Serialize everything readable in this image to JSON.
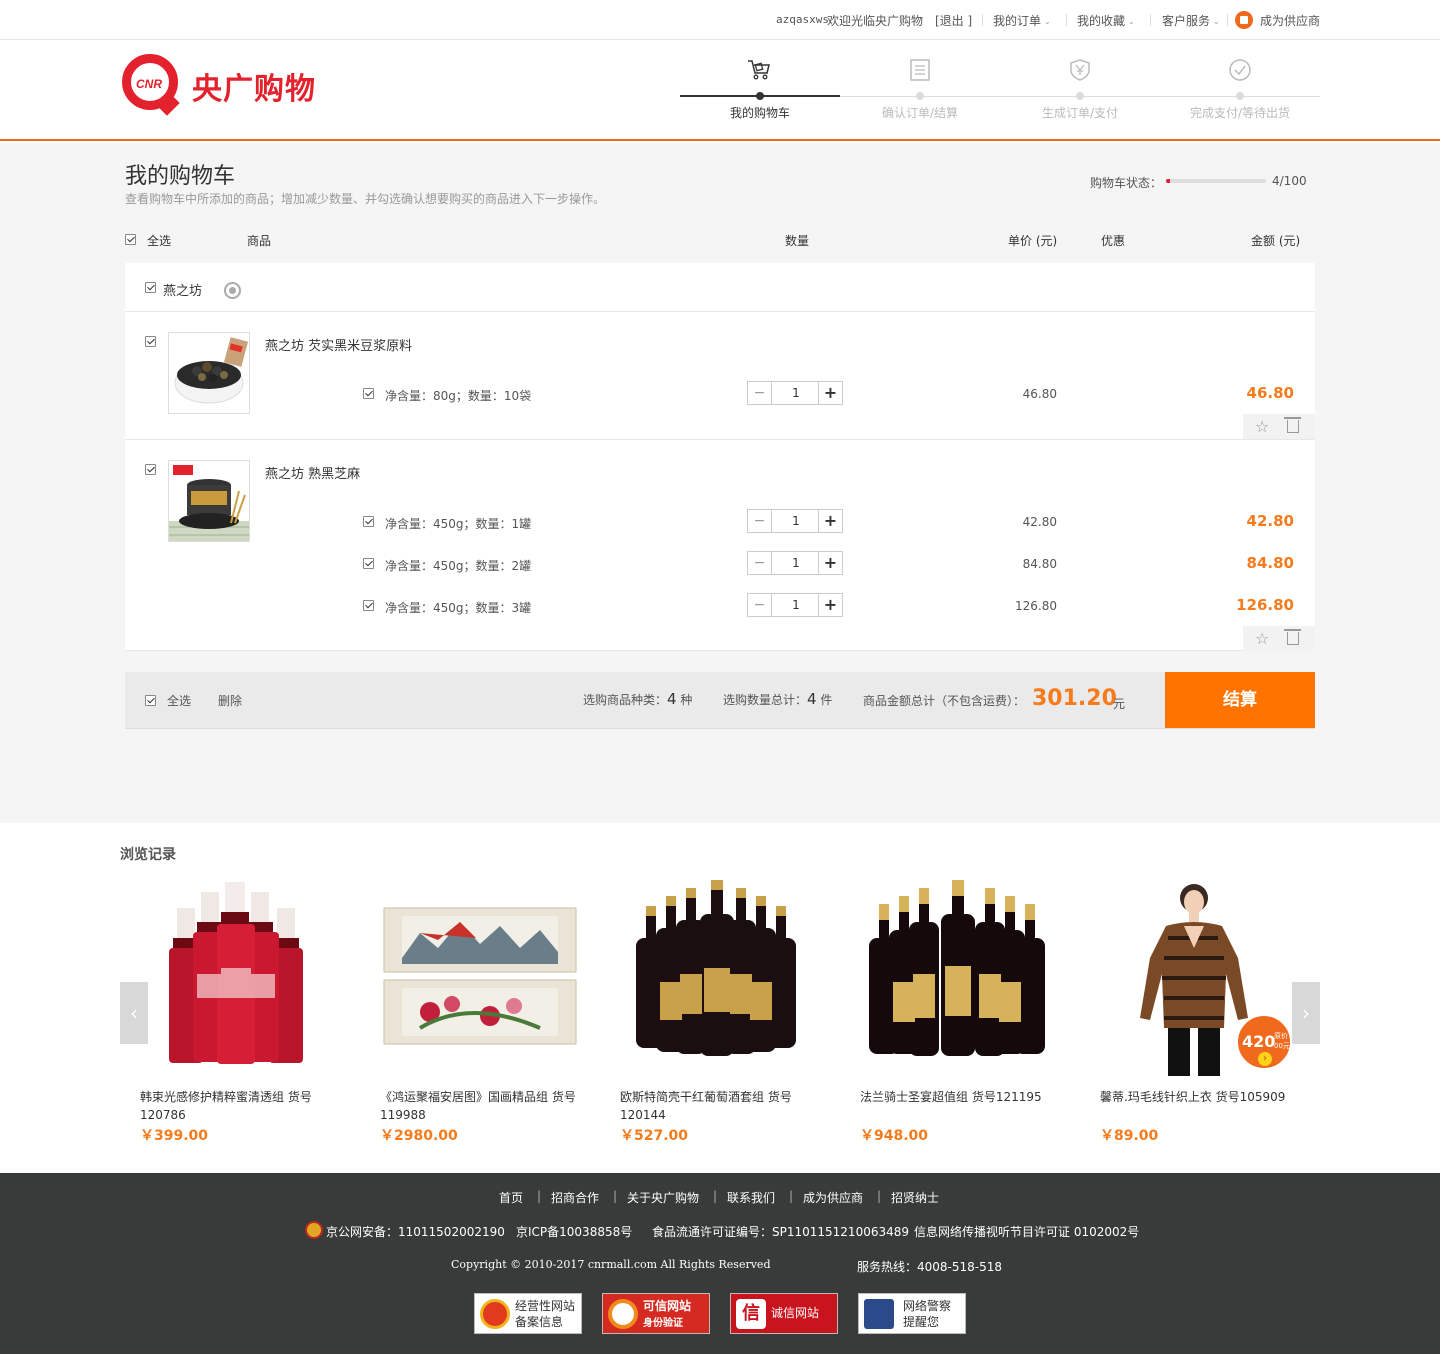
{
  "topbar": {
    "username": "azqasxws",
    "welcome": "欢迎光临央广购物",
    "logout": "[退出 ]",
    "my_orders": "我的订单",
    "my_favorites": "我的收藏",
    "customer_service": "客户服务",
    "become_supplier": "成为供应商"
  },
  "logo": {
    "brand": "央广购物",
    "mark": "CNR"
  },
  "steps": [
    {
      "label": "我的购物车",
      "active": true,
      "icon": "cart-icon"
    },
    {
      "label": "确认订单/结算",
      "active": false,
      "icon": "document-icon"
    },
    {
      "label": "生成订单/支付",
      "active": false,
      "icon": "yuan-shield-icon"
    },
    {
      "label": "完成支付/等待出货",
      "active": false,
      "icon": "check-circle-icon"
    }
  ],
  "cart": {
    "title": "我的购物车",
    "description": "查看购物车中所添加的商品；增加减少数量、并勾选确认想要购买的商品进入下一步操作。",
    "status_label": "购物车状态：",
    "status_count": "4/100",
    "status_fraction": 0.04,
    "columns": {
      "select_all": "全选",
      "product": "商品",
      "quantity": "数量",
      "unit_price": "单价 (元)",
      "discount": "优惠",
      "amount": "金额 (元)"
    },
    "shop_name": "燕之坊",
    "products": [
      {
        "name": "燕之坊 芡实黑米豆浆原料",
        "specs": [
          {
            "spec": "净含量：80g；数量：10袋",
            "qty": "1",
            "price": "46.80",
            "amount": "46.80"
          }
        ]
      },
      {
        "name": "燕之坊 熟黑芝麻",
        "specs": [
          {
            "spec": "净含量：450g；数量：1罐",
            "qty": "1",
            "price": "42.80",
            "amount": "42.80"
          },
          {
            "spec": "净含量：450g；数量：2罐",
            "qty": "1",
            "price": "84.80",
            "amount": "84.80"
          },
          {
            "spec": "净含量：450g；数量：3罐",
            "qty": "1",
            "price": "126.80",
            "amount": "126.80"
          }
        ]
      }
    ],
    "footer": {
      "select_all": "全选",
      "delete": "删除",
      "kinds_label": "选购商品种类：",
      "kinds": "4",
      "kinds_unit": "种",
      "count_label": "选购数量总计：",
      "count": "4",
      "count_unit": "件",
      "total_label": "商品金额总计（不包含运费）：",
      "total": "301.20",
      "total_unit": "元",
      "checkout": "结算"
    }
  },
  "browse": {
    "title": "浏览记录",
    "items": [
      {
        "name": "韩束光感修护精粹蜜清透组 货号120786",
        "price": "￥399.00"
      },
      {
        "name": "《鸿运聚福安居图》国画精品组 货号119988",
        "price": "￥2980.00"
      },
      {
        "name": "欧斯特简壳干红葡萄酒套组 货号120144",
        "price": "￥527.00"
      },
      {
        "name": "法兰骑士圣宴超值组 货号121195",
        "price": "￥948.00"
      },
      {
        "name": "馨蒂.玛毛线针织上衣 货号105909",
        "price": "￥89.00"
      }
    ],
    "promo_badge": {
      "price": "420",
      "note1": "原价",
      "note2": "00元"
    }
  },
  "site_footer": {
    "nav": [
      "首页",
      "招商合作",
      "关于央广购物",
      "联系我们",
      "成为供应商",
      "招贤纳士"
    ],
    "police": "京公网安备：11011502002190",
    "icp": "京ICP备10038858号",
    "food": "食品流通许可证编号：SP1101151210063489",
    "broadcast": "信息网络传播视听节目许可证  0102002号",
    "copyright": "Copyright © 2010-2017  cnrmall.com  All  Rights  Reserved",
    "hotline": "服务热线：4008-518-518",
    "badges": [
      {
        "line1": "经营性网站",
        "line2": "备案信息"
      },
      {
        "line1": "可信网站",
        "line2": "身份验证"
      },
      {
        "line1": "诚信网站",
        "line2": ""
      },
      {
        "line1": "网络警察",
        "line2": "提醒您"
      }
    ]
  }
}
